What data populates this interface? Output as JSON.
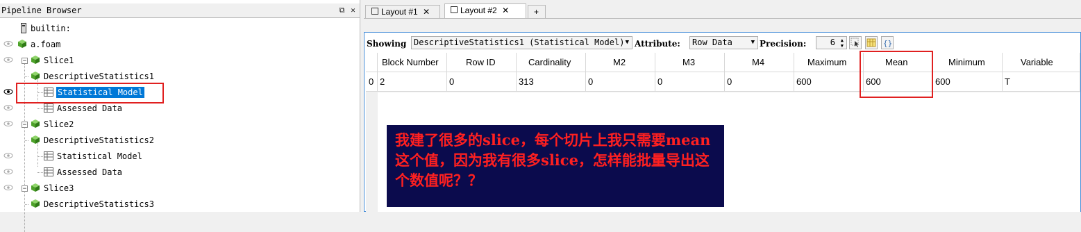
{
  "pipeline_browser": {
    "title": "Pipeline Browser",
    "float_icon": "⧉",
    "close_icon": "✕",
    "items": [
      {
        "label": "builtin:"
      },
      {
        "label": "a.foam"
      },
      {
        "label": "Slice1"
      },
      {
        "label": "DescriptiveStatistics1"
      },
      {
        "label": "Statistical Model",
        "selected": true
      },
      {
        "label": "Assessed Data"
      },
      {
        "label": "Slice2"
      },
      {
        "label": "DescriptiveStatistics2"
      },
      {
        "label": "Statistical Model"
      },
      {
        "label": "Assessed Data"
      },
      {
        "label": "Slice3"
      },
      {
        "label": "DescriptiveStatistics3"
      }
    ]
  },
  "tabs": [
    {
      "label": "Layout #1"
    },
    {
      "label": "Layout #2"
    },
    {
      "label": "+"
    }
  ],
  "tab_close": "✕",
  "toolbar": {
    "showing_label": "Showing",
    "showing_value": "DescriptiveStatistics1 (Statistical Model)",
    "attribute_label": "Attribute:",
    "attribute_value": "Row Data",
    "precision_label": "Precision:",
    "precision_value": "6"
  },
  "spreadsheet": {
    "columns": [
      "Block Number",
      "Row ID",
      "Cardinality",
      "M2",
      "M3",
      "M4",
      "Maximum",
      "Mean",
      "Minimum",
      "Variable"
    ],
    "row_index": "0",
    "rows": [
      [
        "2",
        "0",
        "313",
        "0",
        "0",
        "0",
        "600",
        "600",
        "600",
        "T"
      ]
    ]
  },
  "annotation": {
    "text": "我建了很多的slice，每个切片上我只需要mean这个值，因为我有很多slice，怎样能批量导出这个数值呢？？"
  },
  "colors": {
    "highlight_red": "#e02020",
    "selection_blue": "#0078d7",
    "note_bg": "#0b0b4d",
    "note_text": "#ff2020"
  }
}
